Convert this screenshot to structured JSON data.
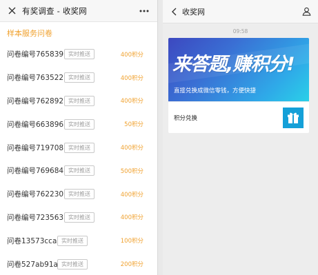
{
  "left": {
    "header": {
      "close_icon": "close-icon",
      "title": "有奖调查 - 收奖网",
      "more_icon": "more-icon"
    },
    "section_title": "样本服务问卷",
    "surveys": [
      {
        "name": "问卷编号765839",
        "tag": "实时推送",
        "points": "400积分"
      },
      {
        "name": "问卷编号763522",
        "tag": "实时推送",
        "points": "400积分"
      },
      {
        "name": "问卷编号762892",
        "tag": "实时推送",
        "points": "400积分"
      },
      {
        "name": "问卷编号663896",
        "tag": "实时推送",
        "points": "50积分"
      },
      {
        "name": "问卷编号719708",
        "tag": "实时推送",
        "points": "400积分"
      },
      {
        "name": "问卷编号769684",
        "tag": "实时推送",
        "points": "500积分"
      },
      {
        "name": "问卷编号762230",
        "tag": "实时推送",
        "points": "400积分"
      },
      {
        "name": "问卷编号723563",
        "tag": "实时推送",
        "points": "400积分"
      },
      {
        "name": "问卷13573cca",
        "tag": "实时推送",
        "points": "100积分"
      },
      {
        "name": "问卷527ab91a",
        "tag": "实时推送",
        "points": "200积分"
      }
    ]
  },
  "right": {
    "header": {
      "back_icon": "back-icon",
      "title": "收奖网",
      "user_icon": "user-icon"
    },
    "timestamp": "09:58",
    "card": {
      "headline": "来答题,赚积分!",
      "subline": "直接兑换成微信零钱，方便快捷",
      "footer_label": "积分兑换",
      "gift_icon": "gift-icon"
    }
  },
  "colors": {
    "accent_orange": "#f0a12e",
    "gift_blue": "#14a0d8",
    "banner_start": "#3c48c0",
    "banner_end": "#2ad0e8"
  }
}
